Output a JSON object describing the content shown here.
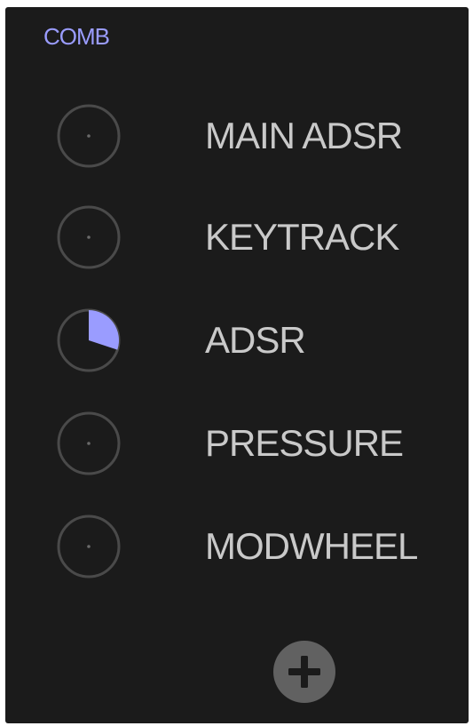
{
  "panel": {
    "title": "COMB"
  },
  "modulators": [
    {
      "label": "MAIN  ADSR",
      "amount": 0
    },
    {
      "label": "KEYTRACK",
      "amount": 0
    },
    {
      "label": "ADSR",
      "amount": 0.35
    },
    {
      "label": "PRESSURE",
      "amount": 0
    },
    {
      "label": "MODWHEEL",
      "amount": 0
    }
  ],
  "colors": {
    "accent": "#9a9cff",
    "knob_ring": "#4a4a4a",
    "label": "#c9c9c9",
    "add_button": "#616161",
    "background": "#1b1b1b"
  },
  "icons": {
    "add": "plus-icon"
  }
}
